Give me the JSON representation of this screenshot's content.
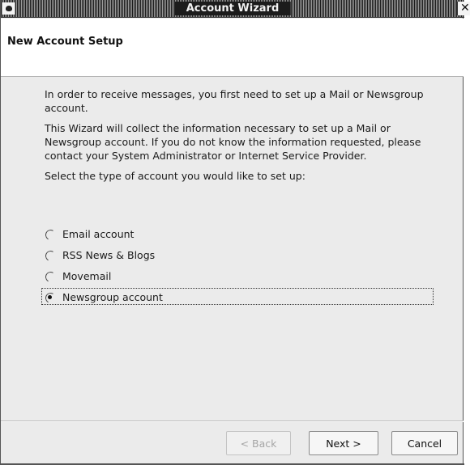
{
  "window": {
    "title": "Account Wizard",
    "close_glyph": "✕"
  },
  "header": {
    "title": "New Account Setup"
  },
  "content": {
    "paragraph1": "In order to receive messages, you first need to set up a Mail or Newsgroup account.",
    "paragraph2": "This Wizard will collect the information necessary to set up a Mail or Newsgroup account. If you do not know the information requested, please contact your System Administrator or Internet Service Provider.",
    "prompt": "Select the type of account you would like to set up:"
  },
  "account_types": {
    "options": [
      {
        "label": "Email account",
        "selected": false
      },
      {
        "label": "RSS News & Blogs",
        "selected": false
      },
      {
        "label": "Movemail",
        "selected": false
      },
      {
        "label": "Newsgroup account",
        "selected": true
      }
    ]
  },
  "buttons": {
    "back_label": "< Back",
    "back_enabled": false,
    "next_label": "Next >",
    "cancel_label": "Cancel"
  }
}
